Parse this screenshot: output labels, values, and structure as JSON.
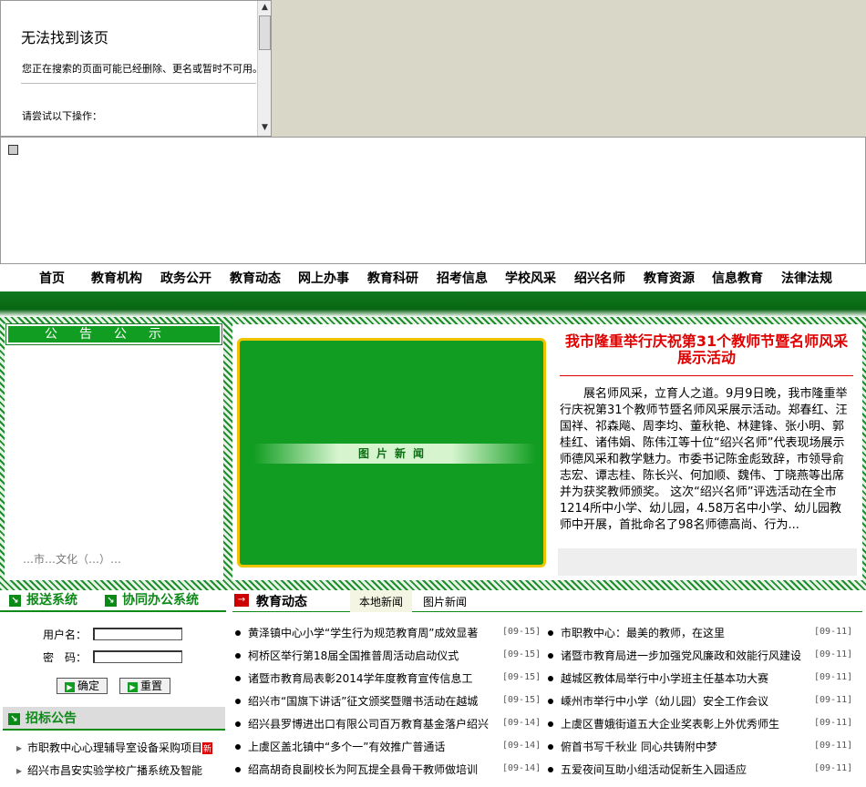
{
  "error_panel": {
    "title": "无法找到该页",
    "desc": "您正在搜索的页面可能已经删除、更名或暂时不可用。",
    "suggest": "请尝试以下操作：",
    "scroll_up": "▲",
    "scroll_down": "▼"
  },
  "nav": [
    "首页",
    "教育机构",
    "政务公开",
    "教育动态",
    "网上办事",
    "教育科研",
    "招考信息",
    "学校风采",
    "绍兴名师",
    "教育资源",
    "信息教育",
    "法律法规"
  ],
  "notice": {
    "title": "公告公示",
    "ticker": "…市…文化（…）…"
  },
  "photo_news": {
    "label": "图片新闻"
  },
  "headline": {
    "title": "我市隆重举行庆祝第31个教师节暨名师风采展示活动",
    "body": "展名师风采，立育人之道。9月9日晚，我市隆重举行庆祝第31个教师节暨名师风采展示活动。郑春红、汪国祥、祁森飚、周李均、董秋艳、林建锋、张小明、郭桂红、诸伟娟、陈伟江等十位“绍兴名师”代表现场展示师德风采和教学魅力。市委书记陈金彪致辞，市领导俞志宏、谭志桂、陈长兴、何加顺、魏伟、丁晓燕等出席并为获奖教师颁奖。 这次“绍兴名师”评选活动在全市1214所中小学、幼儿园，4.58万名中小学、幼儿园教师中开展，首批命名了98名师德高尚、行为..."
  },
  "systems": {
    "submit": "报送系统",
    "office": "协同办公系统",
    "icon": "↘"
  },
  "login": {
    "user_label": "用户名：",
    "pass_label": "密　码：",
    "ok": "确定",
    "reset": "重置",
    "ok_icon": "▶",
    "reset_icon": "▶"
  },
  "tender": {
    "title": "招标公告",
    "items": [
      "市职教中心心理辅导室设备采购项目",
      "绍兴市昌安实验学校广播系统及智能"
    ],
    "new": "新"
  },
  "edu": {
    "title": "教育动态",
    "arrow": "→",
    "tabs": [
      "本地新闻",
      "图片新闻"
    ],
    "left": [
      {
        "t": "黄泽镇中心小学“学生行为规范教育周”成效显著",
        "d": "[09-15]"
      },
      {
        "t": "柯桥区举行第18届全国推普周活动启动仪式",
        "d": "[09-15]"
      },
      {
        "t": "诸暨市教育局表彰2014学年度教育宣传信息工",
        "d": "[09-15]"
      },
      {
        "t": "绍兴市“国旗下讲话”征文颁奖暨赠书活动在越城",
        "d": "[09-15]"
      },
      {
        "t": "绍兴县罗博进出口有限公司百万教育基金落户绍兴",
        "d": "[09-14]"
      },
      {
        "t": "上虞区盖北镇中“多个一”有效推广普通话",
        "d": "[09-14]"
      },
      {
        "t": "绍高胡奇良副校长为阿瓦提全县骨干教师做培训",
        "d": "[09-14]"
      }
    ],
    "right": [
      {
        "t": "市职教中心：最美的教师，在这里",
        "d": "[09-11]"
      },
      {
        "t": "诸暨市教育局进一步加强党风廉政和效能行风建设",
        "d": "[09-11]"
      },
      {
        "t": "越城区教体局举行中小学班主任基本功大赛",
        "d": "[09-11]"
      },
      {
        "t": "嵊州市举行中小学（幼儿园）安全工作会议",
        "d": "[09-11]"
      },
      {
        "t": "上虞区曹娥街道五大企业奖表彰上外优秀师生",
        "d": "[09-11]"
      },
      {
        "t": "俯首书写千秋业 同心共铸附中梦",
        "d": "[09-11]"
      },
      {
        "t": "五爱夜间互助小组活动促新生入园适应",
        "d": "[09-11]"
      }
    ]
  }
}
